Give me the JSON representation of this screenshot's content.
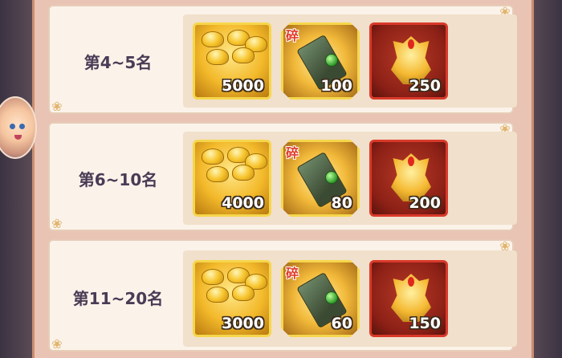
{
  "rank_rows": [
    {
      "rank_label": "第4~5名",
      "rewards": [
        {
          "icon": "gold-ingot-icon",
          "count": "5000"
        },
        {
          "icon": "equipment-fragment-icon",
          "tag": "碎",
          "count": "100"
        },
        {
          "icon": "dragon-mask-icon",
          "count": "250"
        }
      ]
    },
    {
      "rank_label": "第6~10名",
      "rewards": [
        {
          "icon": "gold-ingot-icon",
          "count": "4000"
        },
        {
          "icon": "equipment-fragment-icon",
          "tag": "碎",
          "count": "80"
        },
        {
          "icon": "dragon-mask-icon",
          "count": "200"
        }
      ]
    },
    {
      "rank_label": "第11~20名",
      "rewards": [
        {
          "icon": "gold-ingot-icon",
          "count": "3000"
        },
        {
          "icon": "equipment-fragment-icon",
          "tag": "碎",
          "count": "60"
        },
        {
          "icon": "dragon-mask-icon",
          "count": "150"
        }
      ]
    }
  ],
  "colors": {
    "gold_border": "#f4d24a",
    "mask_border": "#d9392a",
    "rank_text": "#4a3b55"
  }
}
